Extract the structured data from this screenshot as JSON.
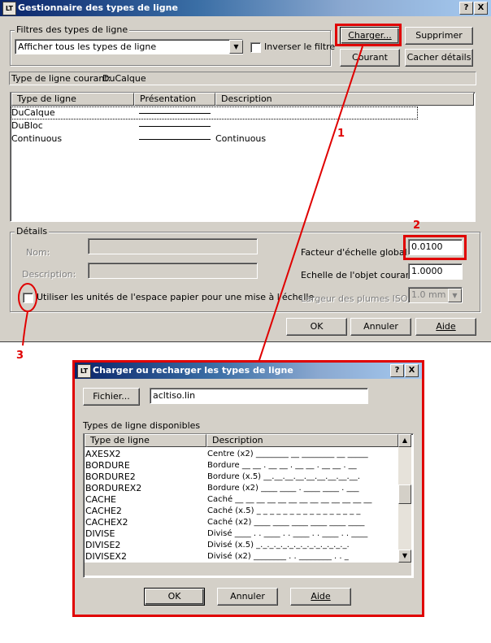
{
  "main_dialog": {
    "title": "Gestionnaire des types de ligne",
    "title_buttons": {
      "help": "?",
      "close": "X"
    },
    "filters_group": "Filtres des types de ligne",
    "filter_value": "Afficher tous les types de ligne",
    "invert_filter": "Inverser le filtre",
    "buttons": {
      "load": "Charger...",
      "delete": "Supprimer",
      "current": "Courant",
      "hide_details": "Cacher détails"
    },
    "current_linetype_label": "Type de ligne courant:",
    "current_linetype_value": "DuCalque",
    "columns": [
      "Type de ligne",
      "Présentation",
      "Description"
    ],
    "rows": [
      {
        "name": "DuCalque",
        "description": ""
      },
      {
        "name": "DuBloc",
        "description": ""
      },
      {
        "name": "Continuous",
        "description": "Continuous"
      }
    ],
    "details": {
      "group": "Détails",
      "name_label": "Nom:",
      "description_label": "Description:",
      "global_scale_label": "Facteur d'échelle global:",
      "global_scale_value": "0.0100",
      "object_scale_label": "Echelle de l'objet courant:",
      "object_scale_value": "1.0000",
      "iso_pen_label": "Largeur des plumes ISO:",
      "iso_pen_value": "1.0 mm",
      "paper_space_checkbox": "Utiliser les unités de l'espace papier pour une mise à l'échelle"
    },
    "bottom_buttons": {
      "ok": "OK",
      "cancel": "Annuler",
      "help": "Aide"
    }
  },
  "annotations": {
    "one": "1",
    "two": "2",
    "three": "3"
  },
  "load_dialog": {
    "title": "Charger ou recharger les types de ligne",
    "title_buttons": {
      "help": "?",
      "close": "X"
    },
    "file_button": "Fichier...",
    "file_value": "acltiso.lin",
    "available_label": "Types de ligne disponibles",
    "columns": [
      "Type de ligne",
      "Description"
    ],
    "rows": [
      {
        "name": "AXESX2",
        "description": "Centre (x2) ________ __ ________ __ _____"
      },
      {
        "name": "BORDURE",
        "description": "Bordure __ __ . __ __ . __ __ . __ __ . __"
      },
      {
        "name": "BORDURE2",
        "description": "Bordure (x.5) __.__.__.__.__.__.__.__.__."
      },
      {
        "name": "BORDUREX2",
        "description": "Bordure (x2) ____ ____ . ____ ____ . ___"
      },
      {
        "name": "CACHE",
        "description": "Caché __ __ __ __ __ __ __ __ __ __ __ __ __"
      },
      {
        "name": "CACHE2",
        "description": "Caché (x.5) _ _ _ _ _ _ _ _ _ _ _ _ _ _ _ _"
      },
      {
        "name": "CACHEX2",
        "description": "Caché (x2) ____ ____ ____ ____ ____ ____"
      },
      {
        "name": "DIVISE",
        "description": "Divisé ____ . . ____ . . ____ . . ____ . . ____"
      },
      {
        "name": "DIVISE2",
        "description": "Divisé (x.5) _._._._._._._._._._._._._._."
      },
      {
        "name": "DIVISEX2",
        "description": "Divisé (x2) ________ . . ________ . . _"
      }
    ],
    "buttons": {
      "ok": "OK",
      "cancel": "Annuler",
      "help": "Aide"
    }
  },
  "colors": {
    "annotation_red": "#e00000",
    "dialog_face": "#d4d0c8",
    "title_dark": "#0a246a"
  }
}
